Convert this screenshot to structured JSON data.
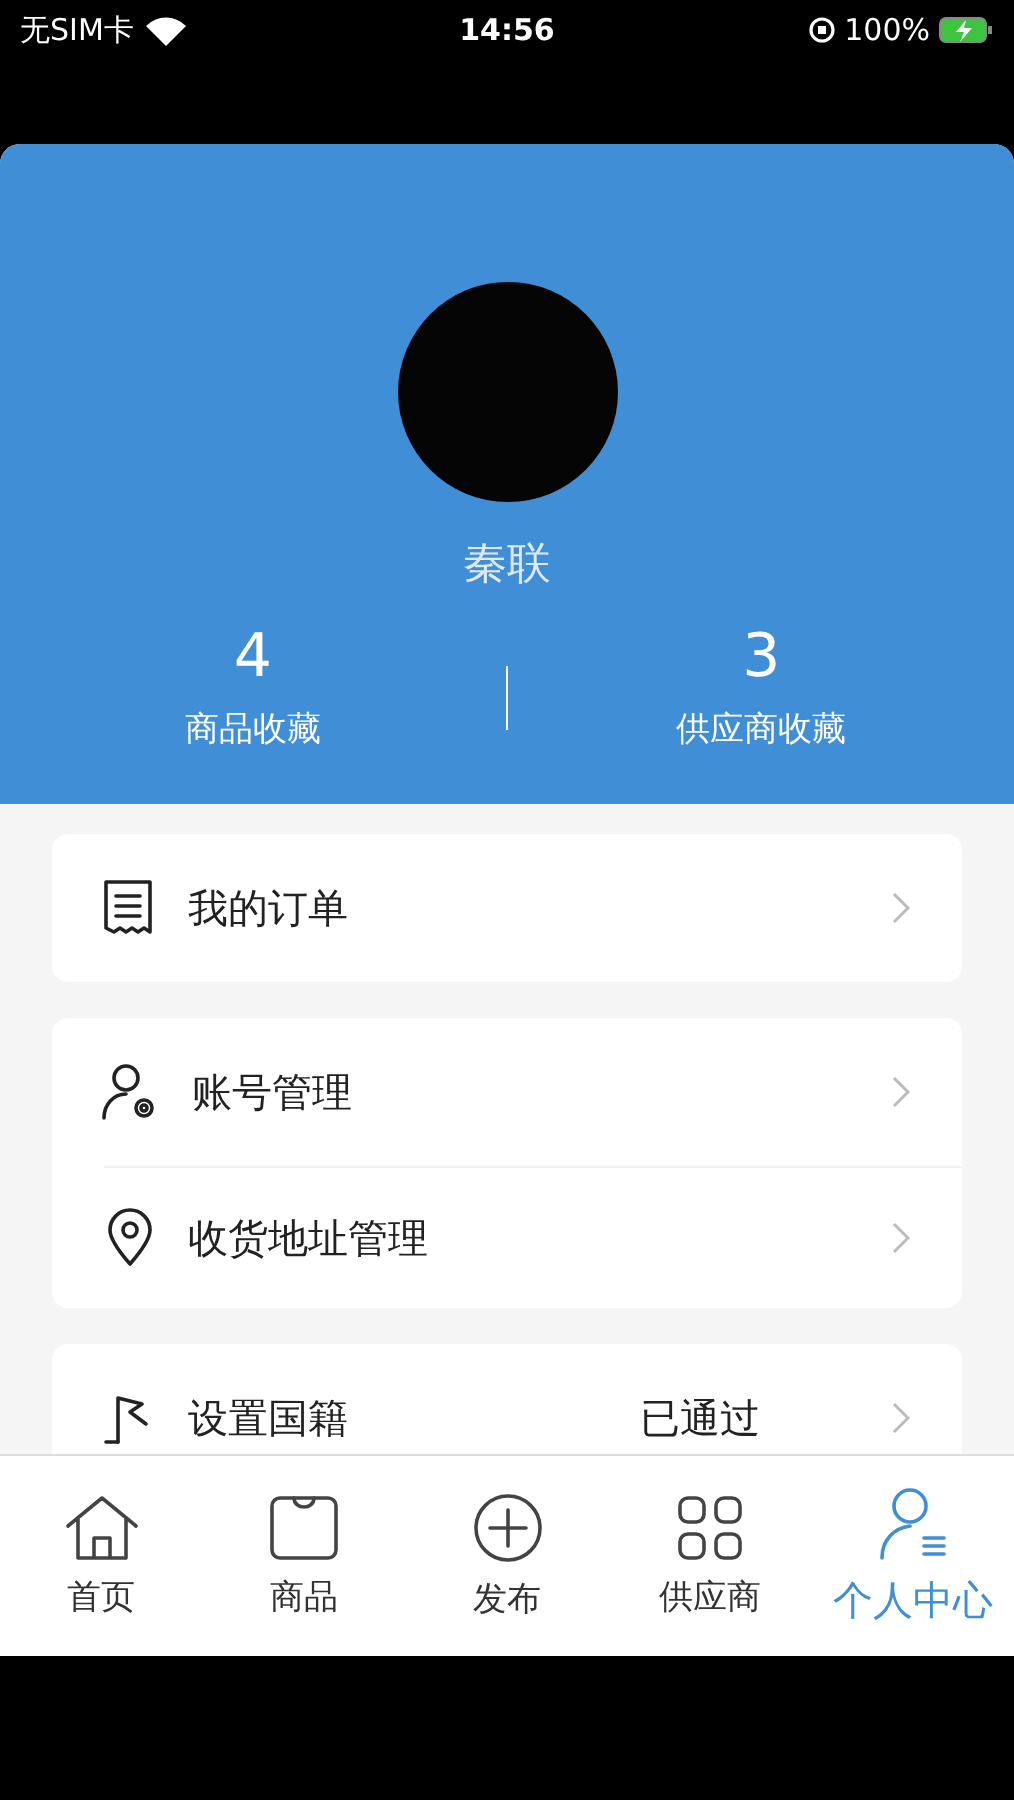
{
  "status_bar": {
    "carrier": "无SIM卡",
    "time": "14:56",
    "battery": "100%"
  },
  "profile": {
    "name": "秦联",
    "stats": [
      {
        "value": "4",
        "label": "商品收藏"
      },
      {
        "value": "3",
        "label": "供应商收藏"
      }
    ]
  },
  "menu_groups": [
    [
      {
        "label": "我的订单"
      }
    ],
    [
      {
        "label": "账号管理"
      },
      {
        "label": "收货地址管理"
      }
    ],
    [
      {
        "label": "设置国籍",
        "value": "已通过"
      }
    ]
  ],
  "tabs": [
    {
      "label": "首页",
      "selected": false
    },
    {
      "label": "商品",
      "selected": false
    },
    {
      "label": "发布",
      "selected": false
    },
    {
      "label": "供应商",
      "selected": false
    },
    {
      "label": "个人中心",
      "selected": true
    }
  ]
}
